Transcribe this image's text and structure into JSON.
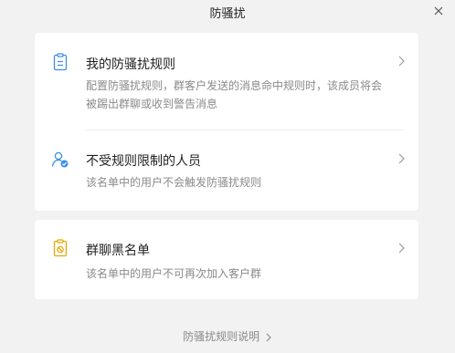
{
  "window": {
    "title": "防骚扰"
  },
  "rules_card": {
    "items": [
      {
        "title": "我的防骚扰规则",
        "description": "配置防骚扰规则，群客户发送的消息命中规则时，该成员将会被踢出群聊或收到警告消息",
        "icon": "clipboard-icon"
      },
      {
        "title": "不受规则限制的人员",
        "description": "该名单中的用户不会触发防骚扰规则",
        "icon": "user-check-icon"
      }
    ]
  },
  "blacklist_card": {
    "title": "群聊黑名单",
    "description": "该名单中的用户不可再次加入客户群",
    "icon": "blocked-list-icon"
  },
  "footer": {
    "link_label": "防骚扰规则说明"
  },
  "colors": {
    "background": "#f2f2f3",
    "card": "#ffffff",
    "icon_blue": "#3d8fe6",
    "icon_yellow": "#e9a800",
    "secondary_text": "#8a8a8a"
  }
}
